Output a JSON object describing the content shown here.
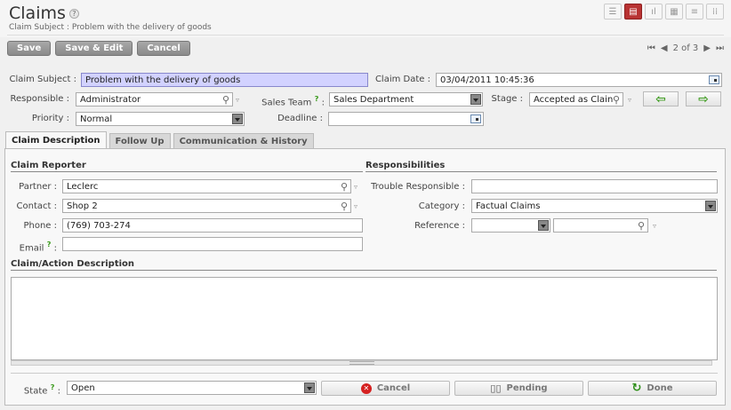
{
  "page": {
    "title": "Claims",
    "help": "?",
    "subtitle": "Claim Subject : Problem with the delivery of goods"
  },
  "view_icons": [
    "list-view-icon",
    "form-view-icon",
    "graph-view-icon",
    "calendar-view-icon",
    "gantt-view-icon",
    "grid-view-icon"
  ],
  "toolbar": {
    "save": "Save",
    "save_edit": "Save & Edit",
    "cancel": "Cancel"
  },
  "pager": {
    "first": "⏮",
    "prev": "◀",
    "text": "2 of 3",
    "next": "▶",
    "last": "⏭"
  },
  "form": {
    "claim_subject_label": "Claim Subject :",
    "claim_subject": "Problem with the delivery of goods",
    "claim_date_label": "Claim Date :",
    "claim_date": "03/04/2011 10:45:36",
    "responsible_label": "Responsible :",
    "responsible": "Administrator",
    "sales_team_label": "Sales Team",
    "sales_team_help": "?",
    "sales_team_colon": ":",
    "sales_team": "Sales Department",
    "stage_label": "Stage :",
    "stage": "Accepted as Clain",
    "priority_label": "Priority :",
    "priority": "Normal",
    "deadline_label": "Deadline :",
    "deadline": ""
  },
  "tabs": [
    "Claim Description",
    "Follow Up",
    "Communication & History"
  ],
  "claim_reporter": {
    "title": "Claim Reporter",
    "partner_label": "Partner :",
    "partner": "Leclerc",
    "contact_label": "Contact :",
    "contact": "Shop 2",
    "phone_label": "Phone :",
    "phone": "(769) 703-274",
    "email_label": "Email",
    "email_help": "?",
    "email_colon": ":",
    "email": ""
  },
  "responsibilities": {
    "title": "Responsibilities",
    "trouble_label": "Trouble Responsible :",
    "trouble": "",
    "category_label": "Category :",
    "category": "Factual Claims",
    "reference_label": "Reference :",
    "reference_model": "",
    "reference_value": ""
  },
  "description": {
    "title": "Claim/Action Description",
    "text": ""
  },
  "state": {
    "label": "State",
    "help": "?",
    "colon": ":",
    "value": "Open",
    "cancel": "Cancel",
    "pending": "Pending",
    "done": "Done"
  }
}
